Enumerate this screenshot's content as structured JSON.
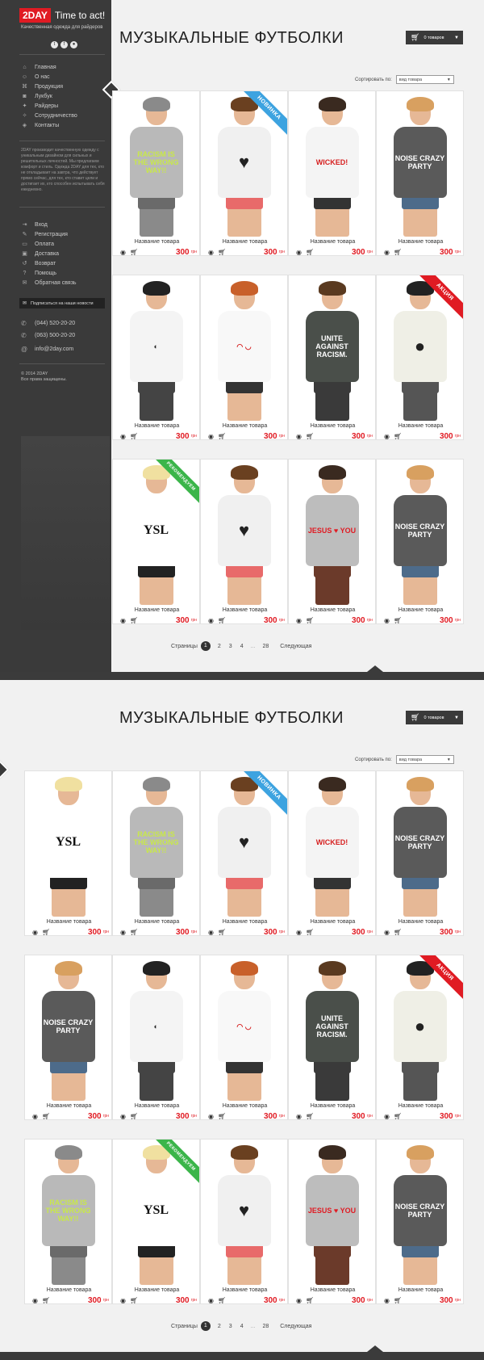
{
  "brand": {
    "badge": "2DAY",
    "slogan": "Time to act!",
    "tagline": "Качественная одежда для райдеров"
  },
  "socials": [
    "t",
    "f",
    "●"
  ],
  "nav_main": [
    {
      "icon": "home-icon",
      "glyph": "⌂",
      "label": "Главная"
    },
    {
      "icon": "users-icon",
      "glyph": "☺",
      "label": "О нас"
    },
    {
      "icon": "shirt-icon",
      "glyph": "⌘",
      "label": "Продукция"
    },
    {
      "icon": "camera-icon",
      "glyph": "◙",
      "label": "Лукбук"
    },
    {
      "icon": "rider-icon",
      "glyph": "✦",
      "label": "Райдеры"
    },
    {
      "icon": "handshake-icon",
      "glyph": "✧",
      "label": "Сотрудничество"
    },
    {
      "icon": "pin-icon",
      "glyph": "◈",
      "label": "Контакты"
    }
  ],
  "about": "2DAY производит качественную одежду с уникальным дизайном для сильных и решительных личностей. Мы предлагаем комфорт и стиль. Одежда 2DAY для тех, кто не откладывает на завтра, что действует прямо сейчас, для тех, кто ставит цели и достигает их, кто способен испытывать себя ежедневно.",
  "nav_user": [
    {
      "icon": "login-icon",
      "glyph": "⇥",
      "label": "Вход"
    },
    {
      "icon": "register-icon",
      "glyph": "✎",
      "label": "Регистрация"
    },
    {
      "icon": "payment-icon",
      "glyph": "▭",
      "label": "Оплата"
    },
    {
      "icon": "delivery-icon",
      "glyph": "▣",
      "label": "Доставка"
    },
    {
      "icon": "return-icon",
      "glyph": "↺",
      "label": "Возврат"
    },
    {
      "icon": "help-icon",
      "glyph": "?",
      "label": "Помощь"
    },
    {
      "icon": "feedback-icon",
      "glyph": "✉",
      "label": "Обратная связь"
    }
  ],
  "subscribe_label": "Подписаться на наши новости",
  "phones": [
    "(044) 520-20-20",
    "(063) 500-20-20"
  ],
  "email": "info@2day.com",
  "copyright": [
    "© 2014 2DAY",
    "Все права защищены."
  ],
  "page_title": "МУЗЫКАЛЬНЫЕ ФУТБОЛКИ",
  "cart_label": "0 товаров",
  "sort_label": "Сортировать по:",
  "sort_value": "вид товара",
  "product_name": "Название товара",
  "price": "300",
  "currency": "грн",
  "ribbons": {
    "new": "НОВИНКА",
    "sale": "АКЦИЯ",
    "rec": "РЕКОМЕНДУЕМ"
  },
  "pager": {
    "label": "Страницы",
    "current": "1",
    "pages": [
      "2",
      "3",
      "4"
    ],
    "dots": "...",
    "last": "28",
    "next": "Следующая"
  },
  "shirt_prints": {
    "racism": "RACISM IS THE WRONG WAY!!",
    "wicked": "WICKED!",
    "noise": "NOISE CRAZY PARTY",
    "unite": "UNITE AGAINST RACISM.",
    "jesus": "JESUS ♥ YOU",
    "ysl": "YSL"
  }
}
